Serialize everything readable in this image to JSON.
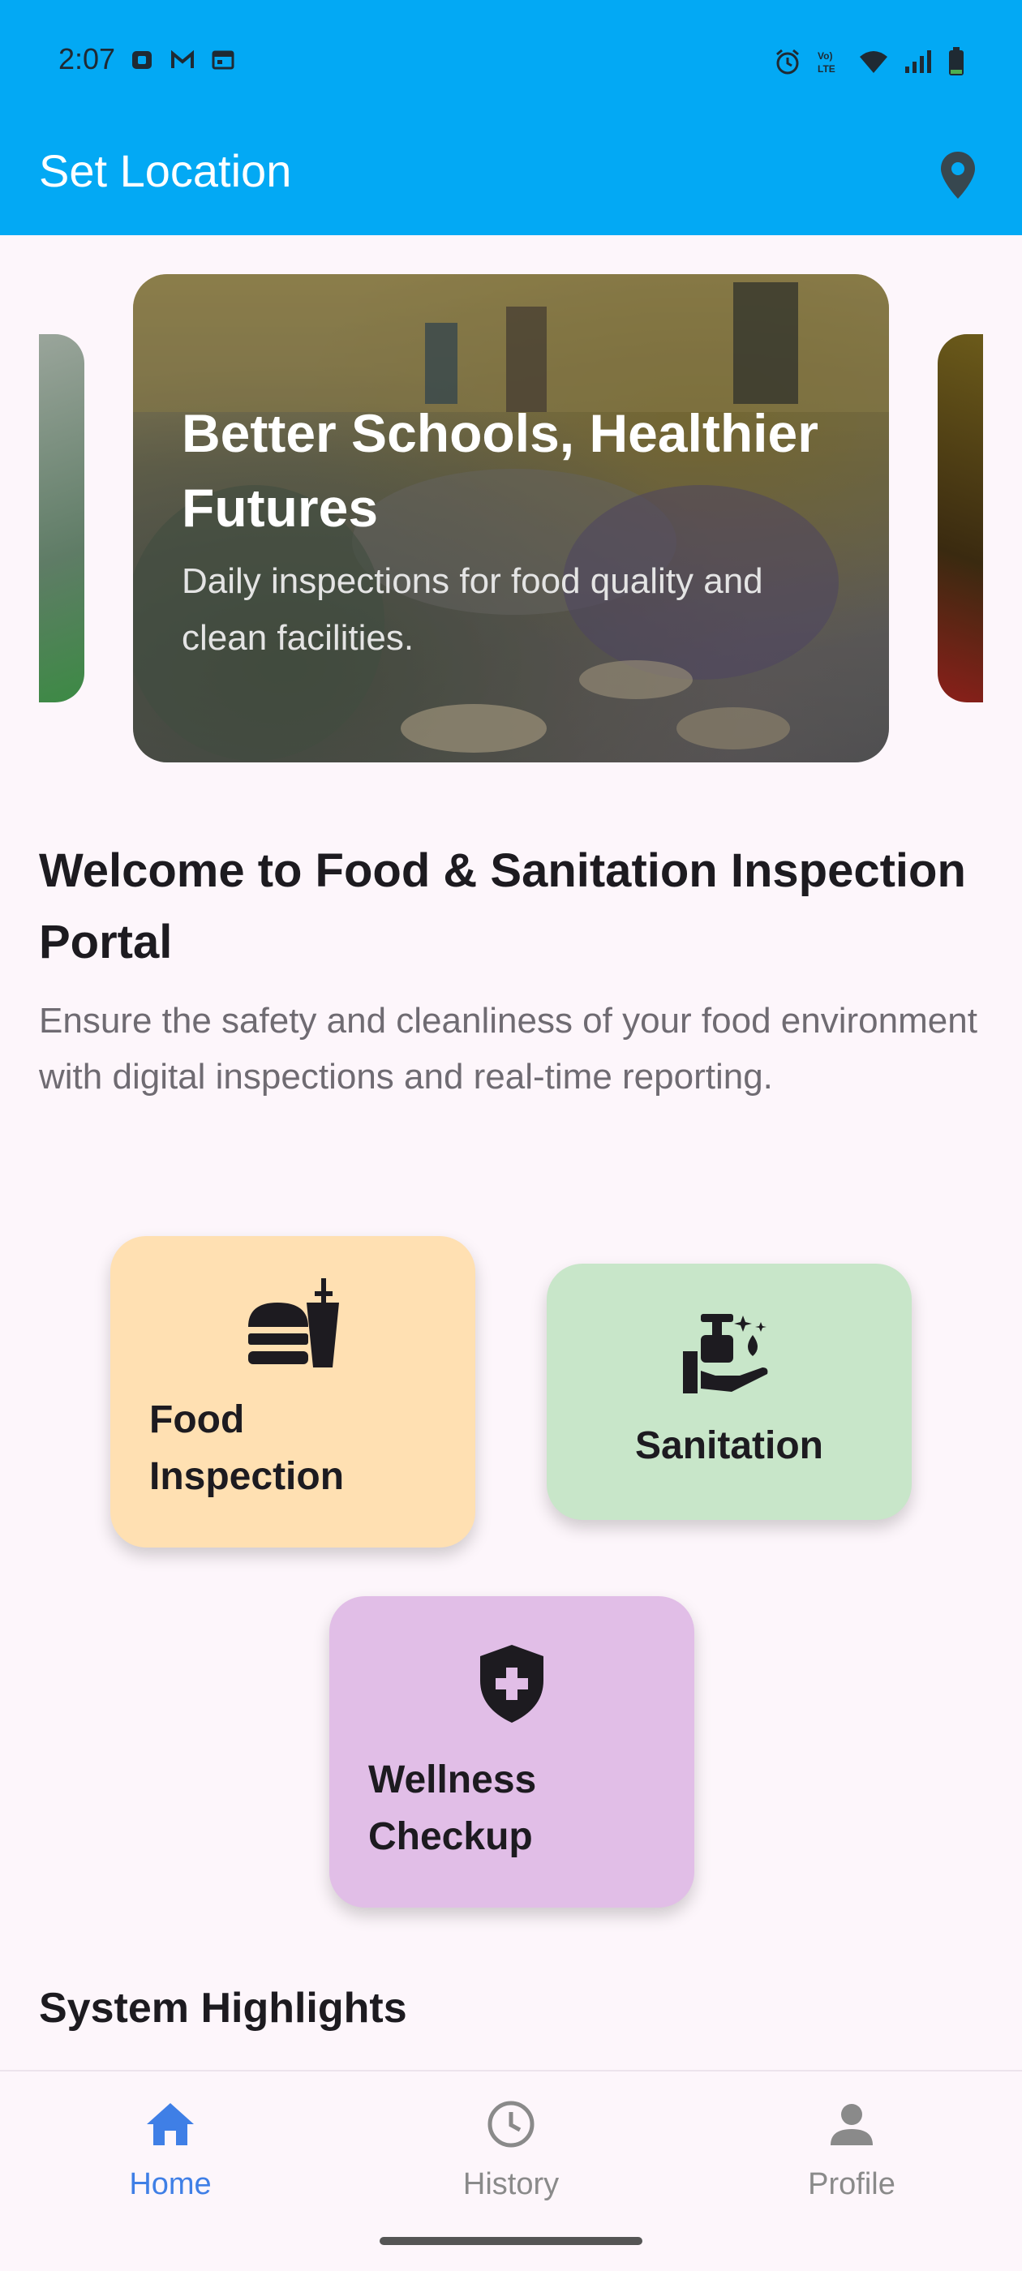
{
  "status_bar": {
    "time": "2:07",
    "left_icons": [
      "notification-icon",
      "gmail-icon",
      "calendar-icon"
    ],
    "right_icons": [
      "alarm-icon",
      "volte-icon",
      "wifi-icon",
      "signal-icon",
      "battery-icon"
    ]
  },
  "app_bar": {
    "title": "Set Location",
    "location_icon": "location-pin-icon"
  },
  "carousel": {
    "slide_title": "Better Schools, Healthier Futures",
    "slide_subtitle": "Daily inspections for food quality and clean facilities."
  },
  "welcome": {
    "title": "Welcome to Food & Sanitation Inspection Portal",
    "description": "Ensure the safety and cleanliness of your food environment with digital inspections and real-time reporting."
  },
  "cards": {
    "food": {
      "label_line1": "Food",
      "label_line2": "Inspection",
      "icon": "fastfood-icon",
      "color": "#ffe0b2"
    },
    "sanitation": {
      "label": "Sanitation",
      "icon": "sanitizer-hand-icon",
      "color": "#c8e6c9"
    },
    "wellness": {
      "label_line1": "Wellness",
      "label_line2": "Checkup",
      "icon": "health-shield-icon",
      "color": "#e1bee7"
    }
  },
  "highlights": {
    "title": "System Highlights"
  },
  "bottom_nav": {
    "items": [
      {
        "label": "Home",
        "icon": "home-icon",
        "active": true
      },
      {
        "label": "History",
        "icon": "clock-icon",
        "active": false
      },
      {
        "label": "Profile",
        "icon": "person-icon",
        "active": false
      }
    ],
    "active_color": "#3f7fe6",
    "inactive_color": "#8a8a8a"
  },
  "colors": {
    "app_bar": "#03a9f4",
    "background": "#fdf6fb"
  }
}
